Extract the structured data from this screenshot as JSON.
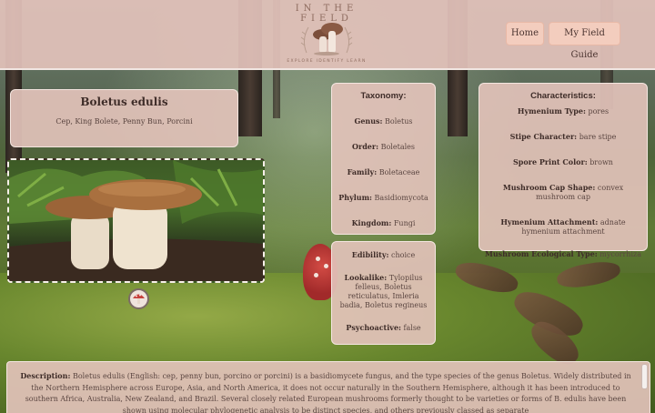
{
  "header": {
    "logo_title": "IN THE FIELD",
    "logo_subtitle": "EXPLORE IDENTIFY LEARN",
    "nav": [
      {
        "label": "Home"
      },
      {
        "label": "My Field Guide"
      }
    ]
  },
  "mushroom": {
    "name": "Boletus edulis",
    "common_names": "Cep, King Bolete, Penny Bun, Porcini"
  },
  "taxonomy": {
    "heading": "Taxonomy:",
    "rows": [
      {
        "label": "Genus:",
        "value": "Boletus"
      },
      {
        "label": "Order:",
        "value": "Boletales"
      },
      {
        "label": "Family:",
        "value": "Boletaceae"
      },
      {
        "label": "Phylum:",
        "value": "Basidiomycota"
      },
      {
        "label": "Kingdom:",
        "value": "Fungi"
      }
    ]
  },
  "characteristics": {
    "heading": "Characteristics:",
    "rows": [
      {
        "label": "Hymenium Type:",
        "value": "pores"
      },
      {
        "label": "Stipe Character:",
        "value": "bare stipe"
      },
      {
        "label": "Spore Print Color:",
        "value": "brown"
      },
      {
        "label": "Mushroom Cap Shape:",
        "value": "convex mushroom cap"
      },
      {
        "label": "Hymenium Attachment:",
        "value": "adnate hymenium attachment"
      },
      {
        "label": "Mushroom Ecological Type:",
        "value": "mycorrhiza"
      }
    ]
  },
  "edibility": {
    "rows": [
      {
        "label": "Edibility:",
        "value": "choice"
      },
      {
        "label": "Lookalike:",
        "value": "Tylopilus felleus, Boletus reticulatus, Imleria badia, Boletus regineus"
      },
      {
        "label": "Psychoactive:",
        "value": "false"
      }
    ]
  },
  "description": {
    "label": "Description:",
    "text": "Boletus edulis (English: cep, penny bun, porcino or porcini) is a basidiomycete fungus, and the type species of the genus Boletus. Widely distributed in the Northern Hemisphere across Europe, Asia, and North America, it does not occur naturally in the Southern Hemisphere, although it has been introduced to southern Africa, Australia, New Zealand, and Brazil. Several closely related European mushrooms formerly thought to be varieties or forms of B. edulis have been shown using molecular phylogenetic analysis to be distinct species, and others previously classed as separate"
  },
  "colors": {
    "panel": "#e2c2ba",
    "button": "#f3cdbe",
    "text": "#4a3a36"
  }
}
